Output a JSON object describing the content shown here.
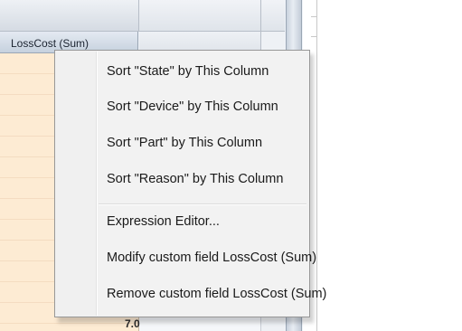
{
  "grid": {
    "column_header": "LossCost (Sum)",
    "peek_value": "7.0"
  },
  "context_menu": {
    "sort_items": [
      "Sort \"State\" by This Column",
      "Sort \"Device\" by This Column",
      "Sort \"Part\" by This Column",
      "Sort \"Reason\" by This Column"
    ],
    "expression_editor": "Expression Editor...",
    "modify_field": "Modify custom field LossCost (Sum)",
    "remove_field": "Remove custom field LossCost (Sum)"
  }
}
